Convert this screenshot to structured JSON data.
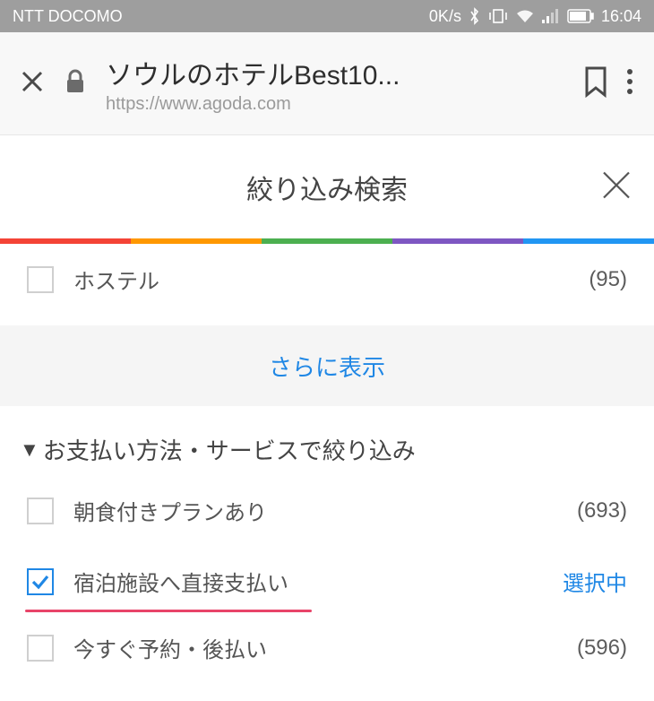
{
  "status": {
    "carrier": "NTT DOCOMO",
    "speed": "0K/s",
    "time": "16:04"
  },
  "browser": {
    "title": "ソウルのホテルBest10...",
    "url": "https://www.agoda.com"
  },
  "page": {
    "title": "絞り込み検索"
  },
  "rainbow_colors": [
    "#f44336",
    "#ff9800",
    "#4caf50",
    "#7e57c2",
    "#2196f3"
  ],
  "filters_top": {
    "hostel": {
      "label": "ホステル",
      "count": "(95)"
    }
  },
  "show_more_label": "さらに表示",
  "section": {
    "title": "お支払い方法・サービスで絞り込み"
  },
  "filters_payment": {
    "breakfast": {
      "label": "朝食付きプランあり",
      "count": "(693)"
    },
    "direct_pay": {
      "label": "宿泊施設へ直接支払い",
      "selected": "選択中"
    },
    "book_now": {
      "label": "今すぐ予約・後払い",
      "count": "(596)"
    }
  }
}
